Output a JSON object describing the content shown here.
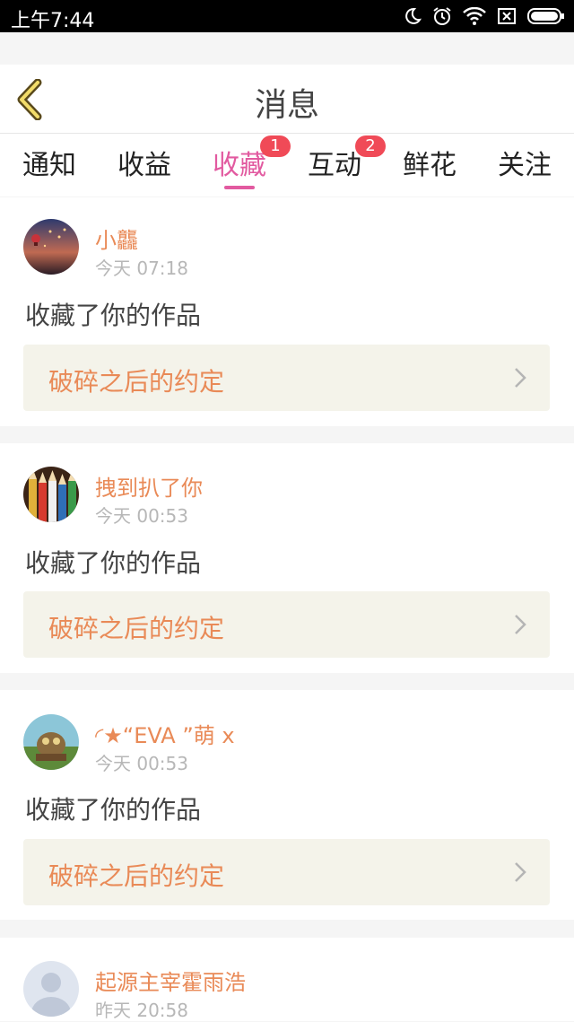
{
  "status_bar": {
    "time": "上午7:44"
  },
  "header": {
    "title": "消息"
  },
  "tabs": [
    {
      "label": "通知"
    },
    {
      "label": "收益"
    },
    {
      "label": "收藏",
      "badge": "1",
      "active": true
    },
    {
      "label": "互动",
      "badge": "2"
    },
    {
      "label": "鲜花"
    },
    {
      "label": "关注"
    }
  ],
  "messages": [
    {
      "name": "小龘",
      "time": "今天 07:18",
      "action": "收藏了你的作品",
      "work": "破碎之后的约定"
    },
    {
      "name": "拽到扒了你",
      "time": "今天 00:53",
      "action": "收藏了你的作品",
      "work": "破碎之后的约定"
    },
    {
      "name": "◜★“EVA ”萌 x",
      "time": "今天 00:53",
      "action": "收藏了你的作品",
      "work": "破碎之后的约定"
    },
    {
      "name": "起源主宰霍雨浩",
      "time": "昨天 20:58"
    }
  ],
  "colors": {
    "accent": "#e25aa0",
    "name": "#e98a57",
    "badge": "#f04a57",
    "work_bg": "#f4f3ea"
  }
}
